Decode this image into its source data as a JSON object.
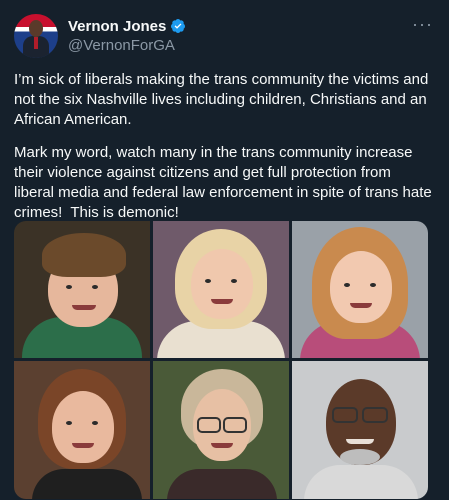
{
  "author": {
    "name": "Vernon Jones",
    "handle": "@VernonForGA",
    "verified_icon": "verified-badge-icon",
    "verified_color": "#1d9bf0"
  },
  "menu": {
    "icon": "more-icon",
    "glyph": "···"
  },
  "tweet": {
    "paragraph1": "I’m sick of liberals making the trans community the victims and not the six Nashville lives including children, Christians and an African American.",
    "paragraph2": "Mark my word, watch many in the trans community increase their violence against citizens and get full protection from liberal media and federal law enforcement in spite of trans hate crimes!  This is demonic!"
  },
  "media": {
    "count": 6,
    "photos": [
      "boy-photo",
      "girl-photo-1",
      "girl-photo-2",
      "woman-photo-1",
      "woman-photo-2",
      "man-photo"
    ]
  },
  "colors": {
    "background": "#15202b",
    "text": "#f7f9f9",
    "secondary_text": "#8b98a5",
    "accent": "#1d9bf0"
  }
}
